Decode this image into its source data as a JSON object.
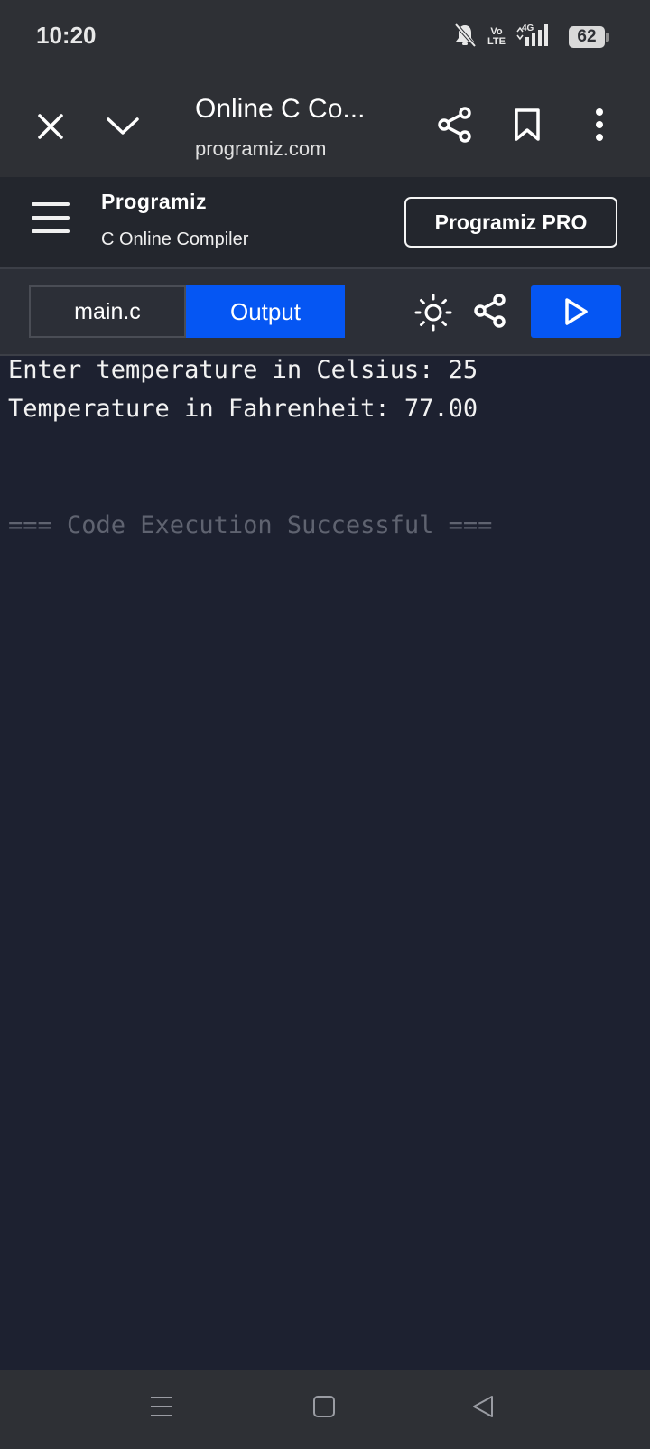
{
  "status_bar": {
    "time": "10:20",
    "network_label": "Vo\nLTE",
    "signal_label": "4G",
    "battery": "62"
  },
  "browser": {
    "title": "Online C Co...",
    "url": "programiz.com",
    "icons": [
      "close-icon",
      "chevron-down-icon",
      "share-icon",
      "bookmark-icon",
      "more-vert-icon"
    ]
  },
  "site_header": {
    "logo": "Programiz",
    "subtitle": "C Online Compiler",
    "pro_button": "Programiz PRO"
  },
  "toolbar": {
    "tabs": [
      {
        "label": "main.c",
        "active": false
      },
      {
        "label": "Output",
        "active": true
      }
    ],
    "icons": [
      "theme-toggle-icon",
      "share-icon",
      "run-icon"
    ],
    "accent_color": "#0556f3"
  },
  "output": {
    "lines": [
      "Enter temperature in Celsius: 25",
      "Temperature in Fahrenheit: 77.00"
    ],
    "status": "=== Code Execution Successful ==="
  },
  "nav_bar": {
    "icons": [
      "recents-icon",
      "home-icon",
      "back-icon"
    ]
  }
}
